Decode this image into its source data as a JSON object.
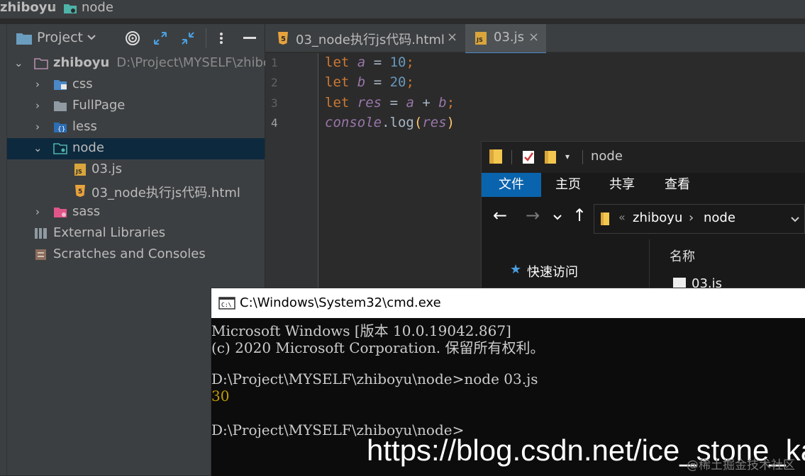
{
  "breadcrumb": {
    "root": "zhiboyu",
    "separator": "›",
    "current": "node"
  },
  "project_panel": {
    "title": "Project",
    "tree": {
      "root": {
        "label": "zhiboyu",
        "path": "D:\\Project\\MYSELF\\zhiboyu"
      },
      "items": [
        {
          "label": "css"
        },
        {
          "label": "FullPage"
        },
        {
          "label": "less"
        },
        {
          "label": "node"
        },
        {
          "label": "03.js"
        },
        {
          "label": "03_node执行js代码.html"
        },
        {
          "label": "sass"
        },
        {
          "label": "External Libraries"
        },
        {
          "label": "Scratches and Consoles"
        }
      ]
    }
  },
  "editor": {
    "tabs": [
      {
        "label": "03_node执行js代码.html",
        "close": "×"
      },
      {
        "label": "03.js",
        "close": "×"
      }
    ],
    "line_numbers": [
      "1",
      "2",
      "3",
      "4"
    ],
    "code": {
      "l1": {
        "kw": "let",
        "var": "a",
        "eq": "=",
        "num": "10",
        "semi": ";"
      },
      "l2": {
        "kw": "let",
        "var": "b",
        "eq": "=",
        "num": "20",
        "semi": ";"
      },
      "l3": {
        "kw": "let",
        "var": "res",
        "eq": "=",
        "a": "a",
        "plus": "+",
        "b": "b",
        "semi": ";"
      },
      "l4": {
        "obj": "console",
        "dot": ".",
        "fn": "log",
        "open": "(",
        "arg": "res",
        "close": ")"
      }
    }
  },
  "explorer": {
    "title": "node",
    "ribbon_tabs": [
      "文件",
      "主页",
      "共享",
      "查看"
    ],
    "address": {
      "part1": "zhiboyu",
      "sep": "›",
      "part2": "node",
      "lead": "«"
    },
    "quick_access": "快速访问",
    "column_name": "名称",
    "file_peek": "03.js"
  },
  "cmd": {
    "title": "C:\\Windows\\System32\\cmd.exe",
    "lines": [
      "Microsoft Windows [版本 10.0.19042.867]",
      "(c) 2020 Microsoft Corporation. 保留所有权利。",
      "D:\\Project\\MYSELF\\zhiboyu\\node>node 03.js",
      "30",
      "D:\\Project\\MYSELF\\zhiboyu\\node>"
    ]
  },
  "watermark": "https://blog.csdn.net/ice_stone_kai",
  "watermark2": "@稀土掘金技术社区",
  "colors": {
    "selection": "#0d293e",
    "accent_blue": "#0a64ad",
    "keyword": "#cc7832",
    "number": "#6897bb",
    "variable": "#9876aa",
    "function": "#ffc66d",
    "output_yellow": "#c19c00"
  }
}
